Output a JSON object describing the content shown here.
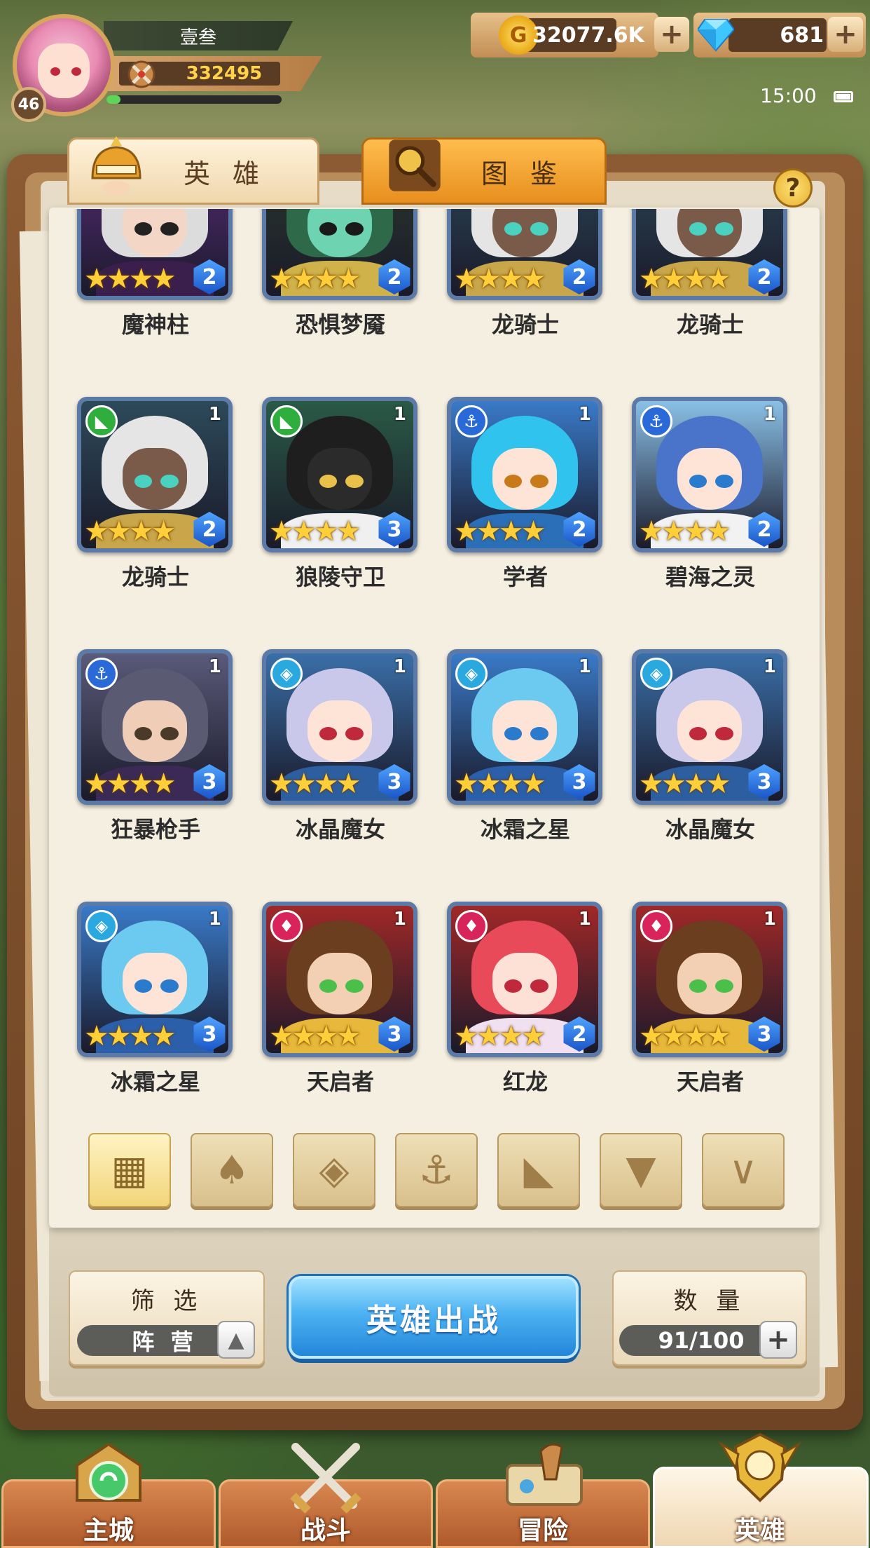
{
  "player": {
    "name": "壹叁",
    "level": "46",
    "power": "332495",
    "xp_fraction": 0.08
  },
  "resources": {
    "gold": "32077.6K",
    "gold_icon": "G",
    "gems": "681",
    "plus": "+"
  },
  "status": {
    "time": "15:00"
  },
  "tabs": [
    {
      "label": "英 雄",
      "icon": "knight-helmet-icon",
      "active": true
    },
    {
      "label": "图 鉴",
      "icon": "magnifier-icon",
      "active": false
    }
  ],
  "help": "?",
  "heroes": [
    {
      "name": "魔神柱",
      "faction": "dark",
      "tier": "",
      "stars": 4,
      "grade": "2",
      "bg": "#5a2c7a",
      "hair": "#dcdcdc",
      "skin": "#f3d6c6",
      "eye": "#222",
      "cloth": "#3a1f4d"
    },
    {
      "name": "恐惧梦魇",
      "faction": "dark",
      "tier": "",
      "stars": 4,
      "grade": "2",
      "bg": "#2c3a2c",
      "hair": "#2e6a4a",
      "skin": "#6ed3b0",
      "eye": "#1a1a1a",
      "cloth": "#d0b24a"
    },
    {
      "name": "龙骑士",
      "faction": "beast",
      "tier": "",
      "stars": 4,
      "grade": "2",
      "bg": "#2d4a5a",
      "hair": "#e5e5e5",
      "skin": "#7a5a48",
      "eye": "#4ad1c0",
      "cloth": "#c9a64a"
    },
    {
      "name": "龙骑士",
      "faction": "beast",
      "tier": "",
      "stars": 4,
      "grade": "2",
      "bg": "#2d4a5a",
      "hair": "#e5e5e5",
      "skin": "#7a5a48",
      "eye": "#4ad1c0",
      "cloth": "#c9a64a"
    },
    {
      "name": "龙骑士",
      "faction": "beast",
      "tier": "1",
      "stars": 4,
      "grade": "2",
      "bg": "#2d4a5a",
      "hair": "#e5e5e5",
      "skin": "#7a5a48",
      "eye": "#4ad1c0",
      "cloth": "#c9a64a"
    },
    {
      "name": "狼陵守卫",
      "faction": "beast",
      "tier": "1",
      "stars": 4,
      "grade": "3",
      "bg": "#2a5a46",
      "hair": "#1e1e1e",
      "skin": "#2b2b2b",
      "eye": "#e8c04a",
      "cloth": "#f0f0f0"
    },
    {
      "name": "学者",
      "faction": "anchor",
      "tier": "1",
      "stars": 4,
      "grade": "2",
      "bg": "#3a7ac8",
      "hair": "#2fc3ee",
      "skin": "#fde4d6",
      "eye": "#c87a1a",
      "cloth": "#2a6fb8"
    },
    {
      "name": "碧海之灵",
      "faction": "anchor",
      "tier": "1",
      "stars": 4,
      "grade": "2",
      "bg": "#8ac0e6",
      "hair": "#4a74c9",
      "skin": "#fde4d6",
      "eye": "#2a7acd",
      "cloth": "#f2f2f2"
    },
    {
      "name": "狂暴枪手",
      "faction": "anchor",
      "tier": "1",
      "stars": 4,
      "grade": "3",
      "bg": "#5a5a7a",
      "hair": "#5a5a72",
      "skin": "#efcdb6",
      "eye": "#4a3a2a",
      "cloth": "#3a2a55"
    },
    {
      "name": "冰晶魔女",
      "faction": "ice",
      "tier": "1",
      "stars": 4,
      "grade": "3",
      "bg": "#3a6fa8",
      "hair": "#c9c8ea",
      "skin": "#fde4d6",
      "eye": "#c0283c",
      "cloth": "#2d5fa0"
    },
    {
      "name": "冰霜之星",
      "faction": "ice",
      "tier": "1",
      "stars": 4,
      "grade": "3",
      "bg": "#3a7ac8",
      "hair": "#6cc9f0",
      "skin": "#fde4d6",
      "eye": "#2a7acd",
      "cloth": "#2b5faa"
    },
    {
      "name": "冰晶魔女",
      "faction": "ice",
      "tier": "1",
      "stars": 4,
      "grade": "3",
      "bg": "#3a6fa8",
      "hair": "#c9c8ea",
      "skin": "#fde4d6",
      "eye": "#c0283c",
      "cloth": "#2d5fa0"
    },
    {
      "name": "冰霜之星",
      "faction": "ice",
      "tier": "1",
      "stars": 4,
      "grade": "3",
      "bg": "#3a7ac8",
      "hair": "#6cc9f0",
      "skin": "#fde4d6",
      "eye": "#2a7acd",
      "cloth": "#2b5faa"
    },
    {
      "name": "天启者",
      "faction": "fire",
      "tier": "1",
      "stars": 4,
      "grade": "3",
      "bg": "#a02828",
      "hair": "#6a3e1e",
      "skin": "#f3d0b4",
      "eye": "#4ac04a",
      "cloth": "#e8b83a"
    },
    {
      "name": "红龙",
      "faction": "fire",
      "tier": "1",
      "stars": 4,
      "grade": "2",
      "bg": "#a02828",
      "hair": "#e84a5a",
      "skin": "#fde0d6",
      "eye": "#c0283c",
      "cloth": "#f0e0f0"
    },
    {
      "name": "天启者",
      "faction": "fire",
      "tier": "1",
      "stars": 4,
      "grade": "3",
      "bg": "#a02828",
      "hair": "#6a3e1e",
      "skin": "#f3d0b4",
      "eye": "#4ac04a",
      "cloth": "#e8b83a"
    }
  ],
  "faction_colors": {
    "dark": "#7a3cb0",
    "beast": "#2fae3e",
    "anchor": "#2a6ad8",
    "ice": "#2aa8e0",
    "fire": "#d8245a"
  },
  "faction_glyphs": {
    "dark": "✦",
    "beast": "◣",
    "anchor": "⚓",
    "ice": "◈",
    "fire": "♦"
  },
  "filters": [
    {
      "icon": "all-grid-icon",
      "glyph": "▦",
      "active": true
    },
    {
      "icon": "fire-faction-icon",
      "glyph": "♠",
      "active": false
    },
    {
      "icon": "ice-faction-icon",
      "glyph": "◈",
      "active": false
    },
    {
      "icon": "anchor-faction-icon",
      "glyph": "⚓",
      "active": false
    },
    {
      "icon": "beast-faction-icon",
      "glyph": "◣",
      "active": false
    },
    {
      "icon": "demon-faction-icon",
      "glyph": "▼",
      "active": false
    },
    {
      "icon": "light-faction-icon",
      "glyph": "∨",
      "active": false
    }
  ],
  "filter_box": {
    "title": "筛 选",
    "value": "阵 营",
    "toggle": "▲"
  },
  "deploy_label": "英雄出战",
  "count_box": {
    "title": "数 量",
    "value": "91/100",
    "plus": "+"
  },
  "nav": [
    {
      "label": "主城",
      "icon": "main-city-icon",
      "active": false
    },
    {
      "label": "战斗",
      "icon": "crossed-swords-icon",
      "active": false
    },
    {
      "label": "冒险",
      "icon": "adventure-map-icon",
      "active": false
    },
    {
      "label": "英雄",
      "icon": "hero-crest-icon",
      "active": true
    }
  ]
}
